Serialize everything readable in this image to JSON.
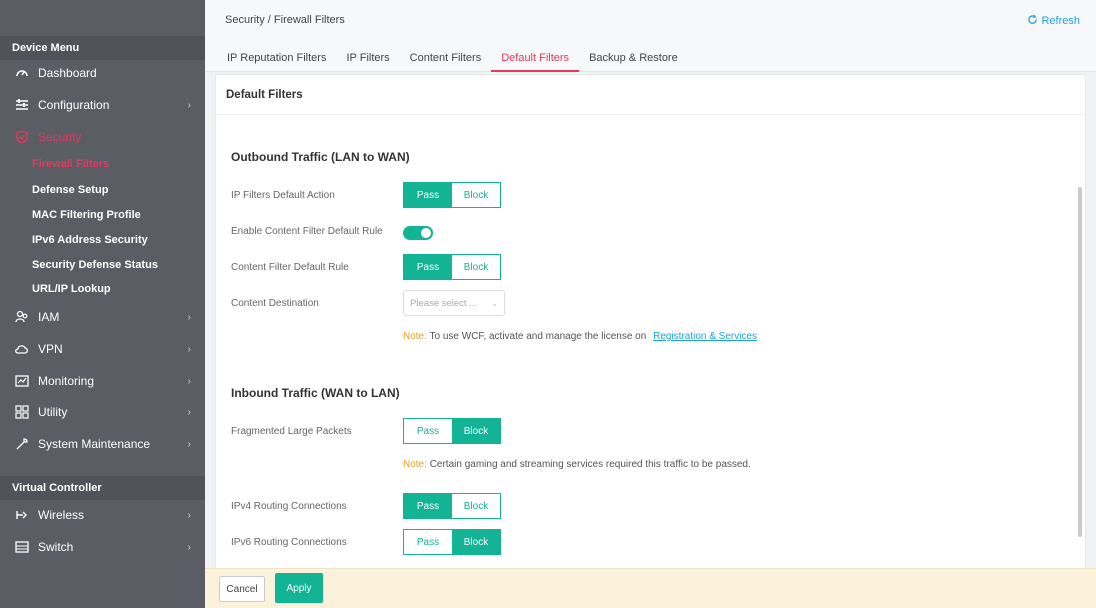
{
  "sidebar": {
    "device_menu_title": "Device Menu",
    "items": [
      {
        "label": "Dashboard",
        "icon": "dashboard-icon"
      },
      {
        "label": "Configuration",
        "icon": "sliders-icon"
      },
      {
        "label": "Security",
        "icon": "shield-icon"
      },
      {
        "label": "IAM",
        "icon": "users-icon"
      },
      {
        "label": "VPN",
        "icon": "cloud-icon"
      },
      {
        "label": "Monitoring",
        "icon": "monitor-icon"
      },
      {
        "label": "Utility",
        "icon": "grid-icon"
      },
      {
        "label": "System Maintenance",
        "icon": "wrench-icon"
      }
    ],
    "security_sub": [
      "Firewall Filters",
      "Defense Setup",
      "MAC Filtering Profile",
      "IPv6 Address Security",
      "Security Defense Status",
      "URL/IP Lookup"
    ],
    "virtual_title": "Virtual Controller",
    "virtual_items": [
      {
        "label": "Wireless",
        "icon": "wireless-icon"
      },
      {
        "label": "Switch",
        "icon": "switch-icon"
      }
    ]
  },
  "header": {
    "breadcrumb": "Security / Firewall Filters",
    "refresh": "Refresh",
    "tabs": [
      "IP Reputation Filters",
      "IP Filters",
      "Content Filters",
      "Default Filters",
      "Backup & Restore"
    ]
  },
  "panel": {
    "title": "Default Filters",
    "outbound_title": "Outbound Traffic (LAN to WAN)",
    "ip_filters_default_action": "IP Filters Default Action",
    "enable_content_filter": "Enable Content Filter Default Rule",
    "content_filter_rule": "Content Filter Default Rule",
    "content_destination": "Content Destination",
    "content_destination_placeholder": "Please select ...",
    "note_label": "Note:",
    "wcf_note": "To use WCF, activate and manage the license on",
    "wcf_link": "Registration & Services",
    "inbound_title": "Inbound Traffic (WAN to LAN)",
    "fragmented": "Fragmented Large Packets",
    "gaming_note": "Certain gaming and streaming services required this traffic to be passed.",
    "ipv4": "IPv4 Routing Connections",
    "ipv6": "IPv6 Routing Connections",
    "pass": "Pass",
    "block": "Block"
  },
  "footer": {
    "cancel": "Cancel",
    "apply": "Apply"
  },
  "colors": {
    "accent": "#13b395",
    "active": "#e8365c",
    "link": "#1ea2d9",
    "note": "#e6a017"
  }
}
